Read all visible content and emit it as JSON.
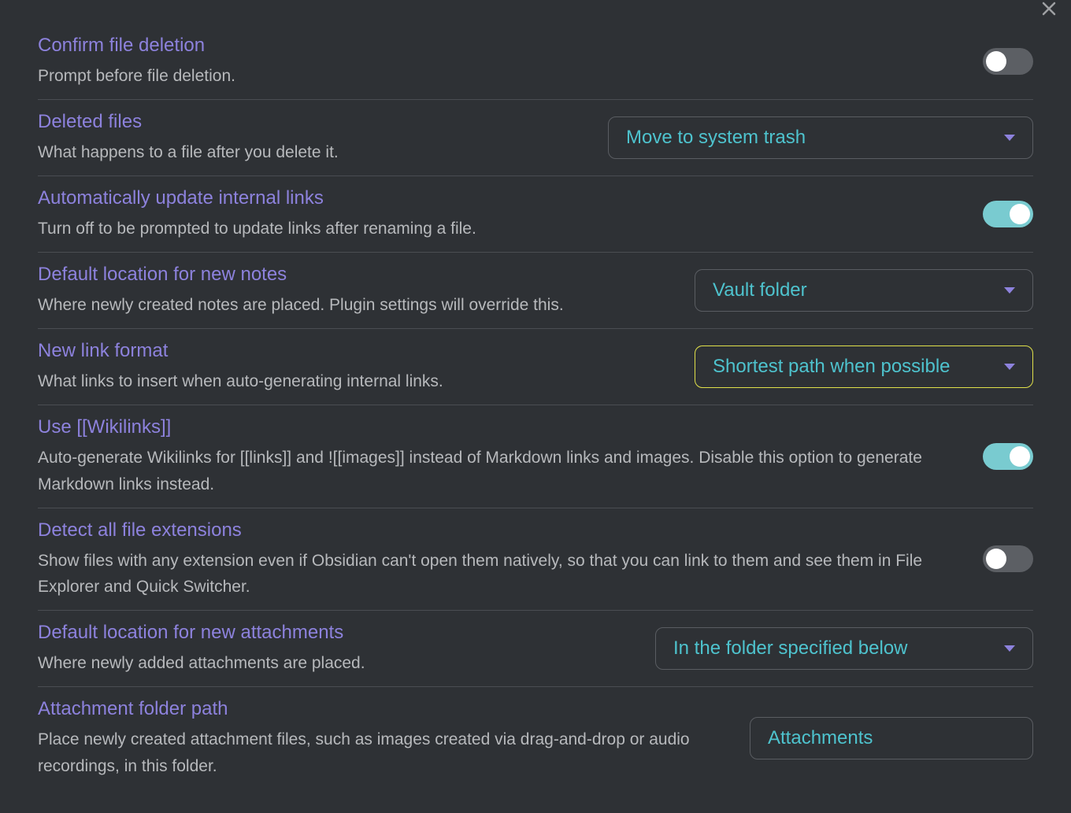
{
  "settings": [
    {
      "key": "confirm_deletion",
      "title": "Confirm file deletion",
      "description": "Prompt before file deletion.",
      "control": "toggle",
      "value": false
    },
    {
      "key": "deleted_files",
      "title": "Deleted files",
      "description": "What happens to a file after you delete it.",
      "control": "dropdown",
      "value": "Move to system trash"
    },
    {
      "key": "auto_update_links",
      "title": "Automatically update internal links",
      "description": "Turn off to be prompted to update links after renaming a file.",
      "control": "toggle",
      "value": true
    },
    {
      "key": "default_note_location",
      "title": "Default location for new notes",
      "description": "Where newly created notes are placed. Plugin settings will override this.",
      "control": "dropdown",
      "value": "Vault folder"
    },
    {
      "key": "new_link_format",
      "title": "New link format",
      "description": "What links to insert when auto-generating internal links.",
      "control": "dropdown",
      "value": "Shortest path when possible",
      "highlighted": true
    },
    {
      "key": "use_wikilinks",
      "title": "Use [[Wikilinks]]",
      "description": "Auto-generate Wikilinks for [[links]] and ![[images]] instead of Markdown links and images. Disable this option to generate Markdown links instead.",
      "control": "toggle",
      "value": true
    },
    {
      "key": "detect_all_extensions",
      "title": "Detect all file extensions",
      "description": "Show files with any extension even if Obsidian can't open them natively, so that you can link to them and see them in File Explorer and Quick Switcher.",
      "control": "toggle",
      "value": false
    },
    {
      "key": "default_attachment_location",
      "title": "Default location for new attachments",
      "description": "Where newly added attachments are placed.",
      "control": "dropdown",
      "value": "In the folder specified below"
    },
    {
      "key": "attachment_folder_path",
      "title": "Attachment folder path",
      "description": "Place newly created attachment files, such as images created via drag-and-drop or audio recordings, in this folder.",
      "control": "text",
      "value": "Attachments"
    }
  ]
}
